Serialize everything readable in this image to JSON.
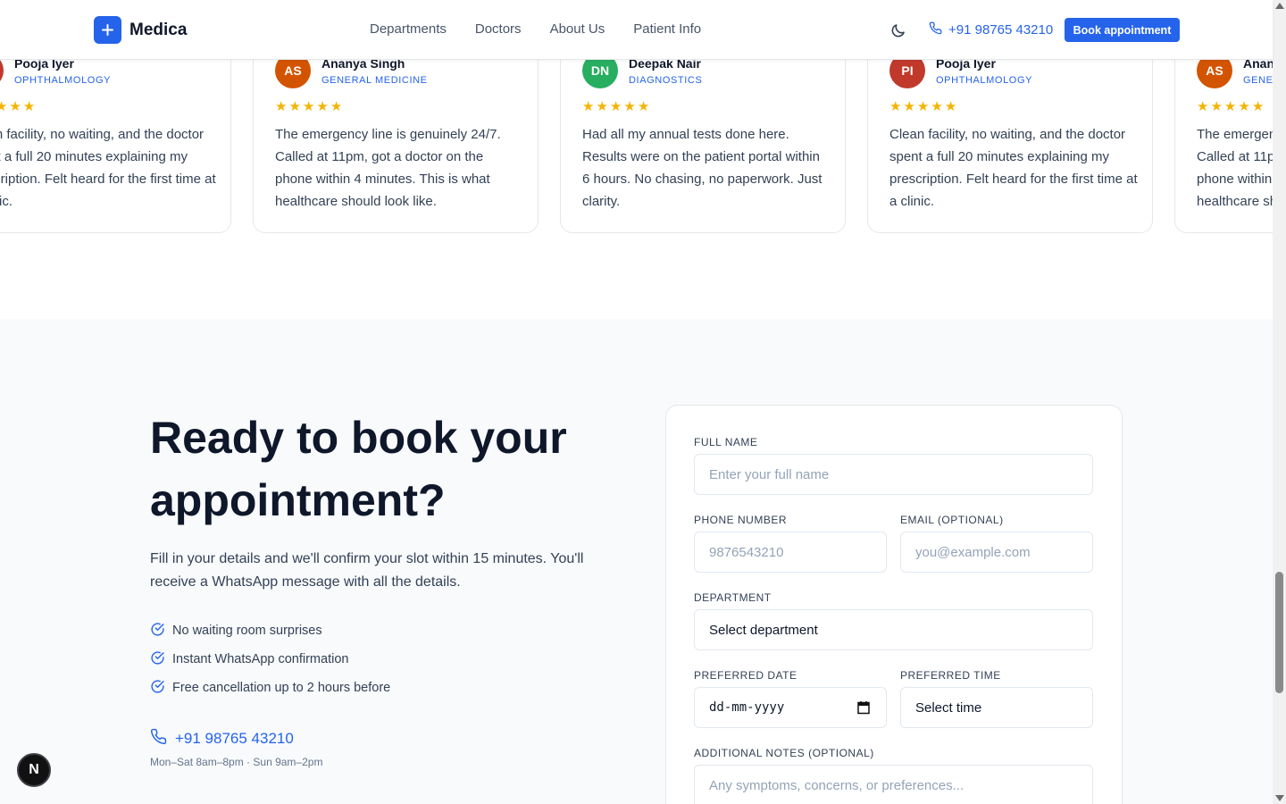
{
  "header": {
    "brand": "Medica",
    "nav": [
      "Departments",
      "Doctors",
      "About Us",
      "Patient Info"
    ],
    "phone": "+91 98765 43210",
    "book_label": "Book appointment"
  },
  "testimonials": [
    {
      "initials": "PI",
      "name": "Pooja Iyer",
      "dept": "OPHTHALMOLOGY",
      "avatar_color": "#c0392b",
      "rating": 5,
      "text": "Clean facility, no waiting, and the doctor spent a full 20 minutes explaining my prescription. Felt heard for the first time at a clinic."
    },
    {
      "initials": "AS",
      "name": "Ananya Singh",
      "dept": "GENERAL MEDICINE",
      "avatar_color": "#d35400",
      "rating": 5,
      "text": "The emergency line is genuinely 24/7. Called at 11pm, got a doctor on the phone within 4 minutes. This is what healthcare should look like."
    },
    {
      "initials": "DN",
      "name": "Deepak Nair",
      "dept": "DIAGNOSTICS",
      "avatar_color": "#27ae60",
      "rating": 5,
      "text": "Had all my annual tests done here. Results were on the patient portal within 6 hours. No chasing, no paperwork. Just clarity."
    },
    {
      "initials": "PI",
      "name": "Pooja Iyer",
      "dept": "OPHTHALMOLOGY",
      "avatar_color": "#c0392b",
      "rating": 5,
      "text": "Clean facility, no waiting, and the doctor spent a full 20 minutes explaining my prescription. Felt heard for the first time at a clinic."
    },
    {
      "initials": "AS",
      "name": "Ananya Singh",
      "dept": "GENERAL MEDICINE",
      "avatar_color": "#d35400",
      "rating": 5,
      "text": "The emergency line is genuinely 24/7. Called at 11pm, got a doctor on the phone within 4 minutes. This is what healthcare should look like."
    }
  ],
  "booking": {
    "title": "Ready to book your appointment?",
    "subtitle": "Fill in your details and we'll confirm your slot within 15 minutes. You'll receive a WhatsApp message with all the details.",
    "features": [
      "No waiting room surprises",
      "Instant WhatsApp confirmation",
      "Free cancellation up to 2 hours before"
    ],
    "phone": "+91 98765 43210",
    "hours": "Mon–Sat 8am–8pm · Sun 9am–2pm"
  },
  "form": {
    "full_name_label": "FULL NAME",
    "full_name_placeholder": "Enter your full name",
    "phone_label": "PHONE NUMBER",
    "phone_placeholder": "9876543210",
    "email_label": "EMAIL (OPTIONAL)",
    "email_placeholder": "you@example.com",
    "department_label": "DEPARTMENT",
    "department_value": "Select department",
    "date_label": "PREFERRED DATE",
    "date_value": "dd-mm-yyyy",
    "time_label": "PREFERRED TIME",
    "time_value": "Select time",
    "notes_label": "ADDITIONAL NOTES (OPTIONAL)",
    "notes_placeholder": "Any symptoms, concerns, or preferences..."
  },
  "dev_badge": "N",
  "colors": {
    "accent": "#2563eb",
    "star": "#f5b400"
  }
}
